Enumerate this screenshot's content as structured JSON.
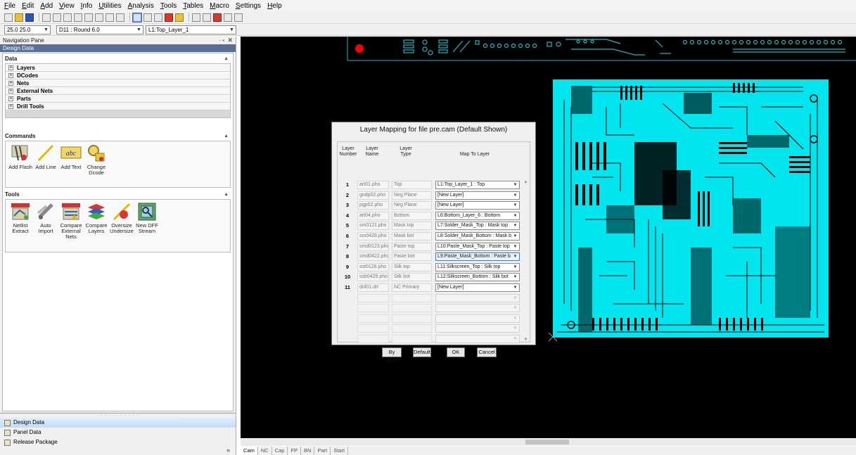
{
  "menu": [
    "File",
    "Edit",
    "Add",
    "View",
    "Info",
    "Utilities",
    "Analysis",
    "Tools",
    "Tables",
    "Macro",
    "Settings",
    "Help"
  ],
  "combos": {
    "grid": "25.0 25.0",
    "dcode": "D11 : Round 6.0",
    "layer": "L1:Top_Layer_1"
  },
  "nav": {
    "title": "Navigation Pane",
    "pin": "- •",
    "close": "✕",
    "design_bar": "Design Data",
    "data_title": "Data",
    "data_items": [
      "Layers",
      "DCodes",
      "Nets",
      "External Nets",
      "Parts",
      "Drill Tools"
    ],
    "commands_title": "Commands",
    "commands": [
      {
        "label": "Add Flash",
        "icon": "add-flash-icon"
      },
      {
        "label": "Add Line",
        "icon": "add-line-icon"
      },
      {
        "label": "Add Text",
        "icon": "add-text-icon"
      },
      {
        "label": "Change Dcode",
        "icon": "change-dcode-icon"
      }
    ],
    "tools_title": "Tools",
    "tools": [
      {
        "label": "Netlist Extract",
        "icon": "netlist-extract-icon"
      },
      {
        "label": "Auto Import",
        "icon": "auto-import-icon"
      },
      {
        "label": "Compare External Nets",
        "icon": "compare-external-nets-icon"
      },
      {
        "label": "Compare Layers",
        "icon": "compare-layers-icon"
      },
      {
        "label": "Oversize Undersize",
        "icon": "oversize-undersize-icon"
      },
      {
        "label": "New DFF Stream",
        "icon": "new-dff-stream-icon"
      }
    ],
    "bottom_items": [
      "Design Data",
      "Panel Data",
      "Release Package"
    ],
    "expand": "»"
  },
  "dialog": {
    "title": "Layer Mapping for file pre.cam (Default Shown)",
    "headers": {
      "number": "Layer Number",
      "name": "Layer Name",
      "type": "Layer Type",
      "map": "Map To Layer"
    },
    "rows": [
      {
        "num": "1",
        "file": "art01.pho",
        "type": "Top",
        "map": "L1:Top_Layer_1 : Top"
      },
      {
        "num": "2",
        "file": "gndp02.pho",
        "type": "Neg Plane",
        "map": "[New Layer]"
      },
      {
        "num": "3",
        "file": "pgp02.pho",
        "type": "Neg Plane",
        "map": "[New Layer]"
      },
      {
        "num": "4",
        "file": "art04.pho",
        "type": "Bottom",
        "map": "L6:Bottom_Layer_6 : Bottom"
      },
      {
        "num": "5",
        "file": "sm0121.pho",
        "type": "Mask top",
        "map": "L7:Solder_Mask_Top : Mask top"
      },
      {
        "num": "6",
        "file": "sm0428.pho",
        "type": "Mask bot",
        "map": "L8:Solder_Mask_Bottom : Mask b"
      },
      {
        "num": "7",
        "file": "smd0123.pho",
        "type": "Paste top",
        "map": "L10:Paste_Mask_Top : Paste top"
      },
      {
        "num": "8",
        "file": "smd0422.pho",
        "type": "Paste bot",
        "map": "L9:Paste_Mask_Bottom : Paste b"
      },
      {
        "num": "9",
        "file": "sst0126.pho",
        "type": "Silk top",
        "map": "L11:Silkscreen_Top : Silk top"
      },
      {
        "num": "10",
        "file": "ssb0429.pho",
        "type": "Silk bot",
        "map": "L12:Silkscreen_Bottom : Silk bot"
      },
      {
        "num": "11",
        "file": "dril01.drl",
        "type": "NC Primary",
        "map": "[New Layer]"
      }
    ],
    "buttons": {
      "bynum": "By Num",
      "default": "Default",
      "ok": "OK",
      "cancel": "Cancel"
    }
  },
  "bottom_tabs": [
    "Cam",
    "NC",
    "Cap",
    "FP",
    "BN",
    "Part",
    "Start"
  ],
  "colors": {
    "board": "#00e5ee",
    "trace": "#16b9c3",
    "pad": "#ff0000",
    "canvas": "#000000",
    "design_bar": "#5a6f94"
  }
}
